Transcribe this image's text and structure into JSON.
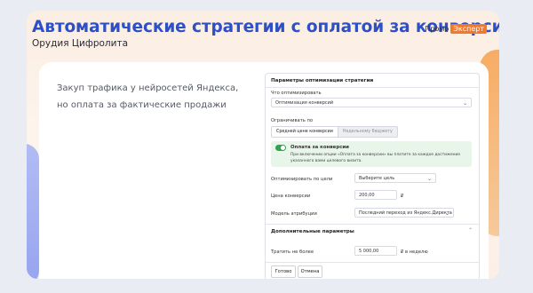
{
  "header": {
    "title": "Автоматические стратегии с оплатой за конверсию",
    "subtitle": "Орудия Цифролита",
    "badge_prefix": "Промо",
    "badge_label": "Эксперт"
  },
  "lead": {
    "line1": "Закуп трафика у нейросетей Яндекса,",
    "line2": "но оплата за фактические продажи"
  },
  "panel": {
    "heading": "Параметры оптимизации стратегии",
    "optimize_label": "Что оптимизировать",
    "optimize_value": "Оптимизация конверсий",
    "limit_label": "Ограничивать по",
    "seg_active": "Средней цене конверсии",
    "seg_inactive": "Недельному бюджету",
    "pay_title": "Оплата за конверсии",
    "pay_desc_1": "При включении опции «Оплата за конверсии» вы платите за каждое достижение",
    "pay_desc_2": "указанного вами целевого визита.",
    "goal_label": "Оптимизировать по цели",
    "goal_value": "Выберите цель",
    "price_label": "Цена конверсии",
    "price_value": "200,00",
    "price_unit": "₽",
    "attr_label": "Модель атрибуции",
    "attr_value": "Последний переход из Яндекс.Директа",
    "extra_heading": "Дополнительные параметры",
    "spend_label": "Тратить не более",
    "spend_value": "5 000,00",
    "spend_unit": "₽ в неделю",
    "done_label": "Готово",
    "cancel_label": "Отмена"
  },
  "colors": {
    "title": "#2d4fc7",
    "badge": "#f5782a",
    "toggle_on": "#2ea44f",
    "info_bg": "#e8f6ea"
  }
}
